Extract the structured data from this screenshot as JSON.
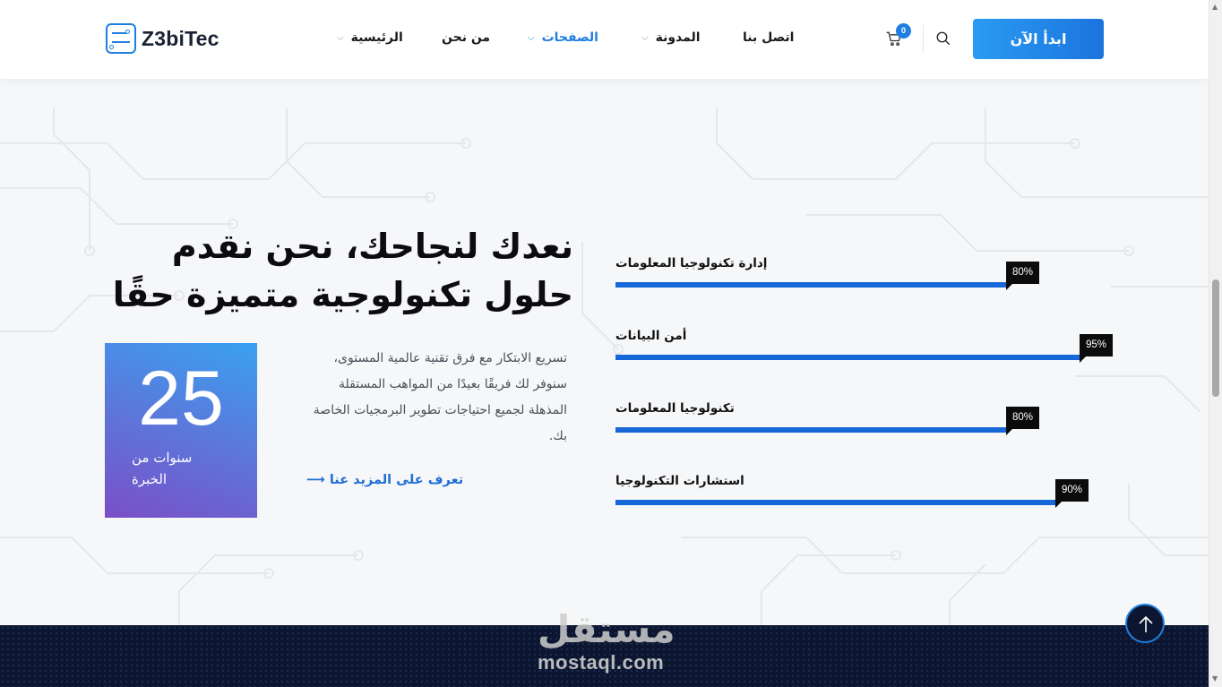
{
  "header": {
    "logo_text": "Z3biTec",
    "nav": [
      {
        "label": "الرئيسية",
        "has_dropdown": true
      },
      {
        "label": "من نحن",
        "has_dropdown": false
      },
      {
        "label": "الصفحات",
        "has_dropdown": true,
        "active": true
      },
      {
        "label": "المدونة",
        "has_dropdown": true
      },
      {
        "label": "اتصل بنا",
        "has_dropdown": false
      }
    ],
    "cart_count": "0",
    "cta_label": "ابدأ الآن"
  },
  "hero": {
    "heading_line1": "نعدك لنجاحك، نحن نقدم",
    "heading_line2": "حلول تكنولوجية متميزة حقًا",
    "experience": {
      "number": "25",
      "label": "سنوات من الخبرة"
    },
    "description": "تسريع الابتكار مع فرق تقنية عالمية المستوى، سنوفر لك فريقًا بعيدًا من المواهب المستقلة المذهلة لجميع احتياجات تطوير البرمجيات الخاصة بك.",
    "more_link": "تعرف على المزيد عنا ⟶"
  },
  "skills": [
    {
      "label": "إدارة تكنولوجيا المعلومات",
      "percent_text": "80%",
      "value": 80
    },
    {
      "label": "أمن البيانات",
      "percent_text": "95%",
      "value": 95
    },
    {
      "label": "تكنولوجيا المعلومات",
      "percent_text": "80%",
      "value": 80
    },
    {
      "label": "استشارات التكنولوجيا",
      "percent_text": "90%",
      "value": 90
    }
  ],
  "watermark": {
    "arabic": "مستقل",
    "latin": "mostaql.com"
  },
  "colors": {
    "accent": "#1f7fe0",
    "progress": "#1668d8",
    "footer_bg": "#0c1630"
  }
}
